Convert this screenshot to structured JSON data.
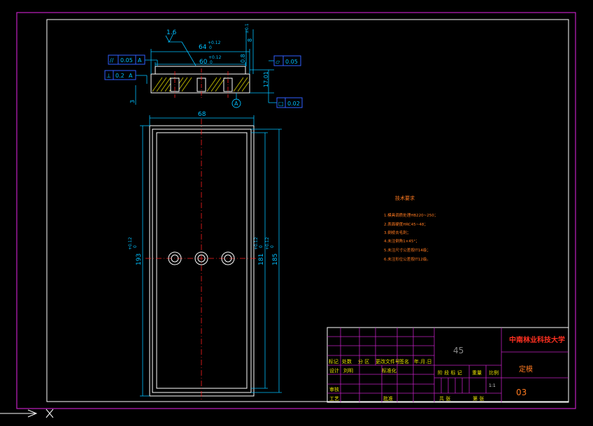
{
  "colors": {
    "background": "#000000",
    "frame_outer": "#c020c0",
    "frame_inner": "#ffffff",
    "dimension": "#00bfff",
    "centerline": "#ff2020",
    "section_hatch": "#e8e000",
    "notes": "#ff6020",
    "title_block": "#c020c0"
  },
  "icons": {
    "origin_axis": "ucs-arrow-icon",
    "origin_cross": "ucs-x-icon"
  },
  "section_view": {
    "roughness": "1.6",
    "dim_overall": "64",
    "dim_overall_tol_upper": "+0.12",
    "dim_overall_tol_lower": "0",
    "dim_inner": "60",
    "dim_inner_tol_upper": "+0.12",
    "dim_inner_tol_lower": "0",
    "dim_height": "8",
    "dim_height_tol": "±0.1",
    "dim_step": "0.8",
    "dim_right": "17.01",
    "dim_left": "3",
    "datum_label": "A",
    "tol_parallel_symbol": "//",
    "tol_parallel_value": "0.05",
    "tol_parallel_datum": "A",
    "tol_perp_symbol": "⊥",
    "tol_perp_value": "0.2",
    "tol_perp_datum": "A",
    "tol_flat_symbol": "▱",
    "tol_flat_value": "0.05",
    "tol_flat2_symbol": "□",
    "tol_flat2_value": "0.02"
  },
  "plan_view": {
    "dim_width": "68",
    "dim_left": "193",
    "dim_left_tol_upper": "+0.12",
    "dim_left_tol_lower": "0",
    "dim_mid": "181",
    "dim_mid_tol_upper": "+0.12",
    "dim_mid_tol_lower": "0",
    "dim_right": "185",
    "dim_right_tol_upper": "+0.12",
    "dim_right_tol_lower": "0",
    "hole_count": 3
  },
  "notes": {
    "title": "技术要求",
    "items": [
      "1.模具调质处理HB220~250；",
      "2.表面硬度HRC45~48；",
      "3.倒棱去毛刺；",
      "4.未注倒角1×45°；",
      "5.未注尺寸公差按IT14级；",
      "6.未注形位公差按IT12级。"
    ]
  },
  "title_block": {
    "material": "45",
    "university": "中南林业科技大学",
    "part_name": "定模",
    "drawing_no": "03",
    "row_labels": [
      "标记",
      "处数",
      "分 区",
      "更改文件号",
      "签名",
      "年.月.日"
    ],
    "designer_label": "设计",
    "designer_name": "刘明",
    "standardize_label": "标准化",
    "review_label": "审核",
    "process_label": "工艺",
    "approve_label": "批准",
    "stage_label": "阶 段 标 记",
    "weight_label": "重量",
    "scale_label": "比例",
    "scale_value": "1:1",
    "sheet_total_label": "共 张",
    "sheet_label": "第 张"
  }
}
